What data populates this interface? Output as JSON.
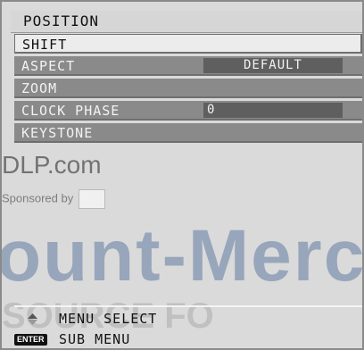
{
  "title": "POSITION",
  "menu": {
    "items": [
      {
        "label": "SHIFT",
        "value": ""
      },
      {
        "label": "ASPECT",
        "value": "DEFAULT"
      },
      {
        "label": "ZOOM",
        "value": ""
      },
      {
        "label": "CLOCK PHASE",
        "value": "0"
      },
      {
        "label": "KEYSTONE",
        "value": ""
      }
    ]
  },
  "help": {
    "menu_select": "MENU SELECT",
    "enter_key": "ENTER",
    "sub_menu": "SUB MENU"
  },
  "watermark": {
    "site": "DLP.com",
    "sponsored": "Sponsored by",
    "brand": "ount-Merch",
    "footer": "SOURCE FO"
  }
}
